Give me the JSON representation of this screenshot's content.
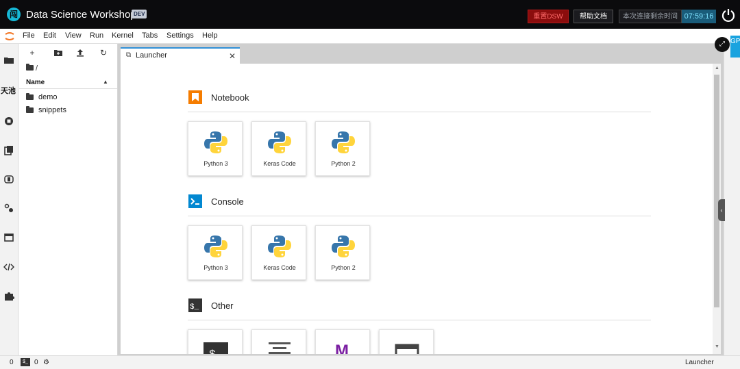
{
  "topbar": {
    "logo_char": "闯",
    "title": "Data Science Workshop",
    "badge": "DEV",
    "reset_label": "重置DSW",
    "help_label": "帮助文档",
    "time_label": "本次连接剩余时间",
    "time_value": "07:59:16"
  },
  "menubar": {
    "items": [
      "File",
      "Edit",
      "View",
      "Run",
      "Kernel",
      "Tabs",
      "Settings",
      "Help"
    ]
  },
  "leftbar": {
    "text_label": "天池",
    "icons": [
      "folder-icon",
      "running-icon",
      "commands-icon",
      "tabs-icon",
      "settings-icon",
      "window-icon",
      "code-icon",
      "extension-icon"
    ]
  },
  "filebrowser": {
    "breadcrumb": "/",
    "column_name": "Name",
    "items": [
      {
        "name": "demo"
      },
      {
        "name": "snippets"
      }
    ]
  },
  "tab": {
    "label": "Launcher"
  },
  "launcher": {
    "sections": [
      {
        "title": "Notebook",
        "items": [
          {
            "label": "Python 3"
          },
          {
            "label": "Keras Code"
          },
          {
            "label": "Python 2"
          }
        ]
      },
      {
        "title": "Console",
        "items": [
          {
            "label": "Python 3"
          },
          {
            "label": "Keras Code"
          },
          {
            "label": "Python 2"
          }
        ]
      },
      {
        "title": "Other",
        "items": [
          {
            "label": ""
          },
          {
            "label": ""
          },
          {
            "label": ""
          },
          {
            "label": ""
          }
        ]
      }
    ]
  },
  "rightbar": {
    "badge": "GPU"
  },
  "statusbar": {
    "left_count_1": "0",
    "left_count_2": "0",
    "right_label": "Launcher"
  },
  "colors": {
    "accent": "#2f8fd6",
    "notebook_orange": "#f57c00",
    "console_blue": "#0288d1",
    "other_dark": "#333333",
    "markdown_purple": "#7b1fa2"
  }
}
